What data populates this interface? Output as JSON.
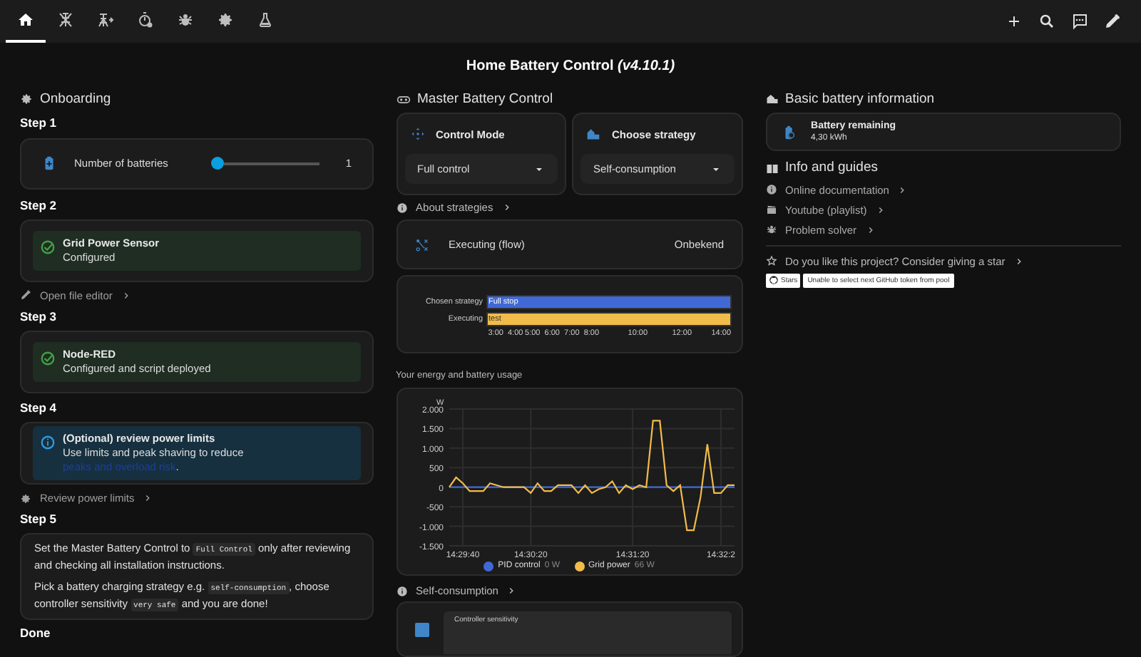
{
  "toolbar": {
    "tabs": [
      {
        "selected": true
      },
      {
        "selected": false
      },
      {
        "selected": false
      },
      {
        "selected": false
      },
      {
        "selected": false
      },
      {
        "selected": false
      },
      {
        "selected": false
      }
    ]
  },
  "title": {
    "name": "Home Battery Control",
    "version": "(v4.10.1)"
  },
  "onboarding": {
    "heading": "Onboarding",
    "steps": [
      {
        "title": "Step 1",
        "kind": "slider",
        "label": "Number of batteries",
        "reading": "1"
      },
      {
        "title": "Step 2",
        "kind": "success",
        "label": "Grid Power Sensor",
        "detail": "Configured",
        "link": "Open file editor"
      },
      {
        "title": "Step 3",
        "kind": "success",
        "label": "Node-RED",
        "detail": "Configured and script deployed"
      },
      {
        "title": "Step 4",
        "kind": "info",
        "label": "(Optional) review power limits",
        "detail": "Use limits and peak shaving to reduce ",
        "detail_link": "peaks and overload risk",
        "detail_end": ".",
        "link": "Review power limits"
      },
      {
        "title": "Step 5",
        "kind": "text",
        "paragraphs": [
          [
            "Set the Master Battery Control to ",
            {
              "code": "Full Control"
            },
            " only after reviewing and checking all installation instructions."
          ],
          [
            "Pick a battery charging strategy e.g. ",
            {
              "code": "self-consumption"
            },
            ", choose controller sensitivity ",
            {
              "code": "very safe"
            },
            " and you are done!"
          ]
        ]
      },
      {
        "title": "Done",
        "kind": "heading"
      }
    ]
  },
  "master": {
    "heading": "Master Battery Control",
    "selects": [
      {
        "label": "Control Mode",
        "value": "Full control"
      },
      {
        "label": "Choose strategy",
        "value": "Self-consumption"
      }
    ],
    "about_link": "About strategies",
    "executing": {
      "label": "Executing (flow)",
      "value": "Onbekend"
    },
    "timeline": {
      "rows": [
        {
          "label": "Chosen strategy",
          "value": "Full stop",
          "color": "#4169d6"
        },
        {
          "label": "Executing",
          "value": "test",
          "color": "#f2bc4a"
        }
      ],
      "ticks": [
        "3:00",
        "4:00",
        "5:00",
        "6:00",
        "7:00",
        "8:00",
        "10:00",
        "12:00",
        "14:00"
      ]
    },
    "usage_heading": "Your energy and battery usage",
    "chart_data": {
      "type": "line",
      "ylabel": "W",
      "ylim": [
        -1500,
        2000
      ],
      "grid": true,
      "legend": true,
      "yticks": [
        {
          "value": 2000,
          "label": "2.000"
        },
        {
          "value": 1500,
          "label": "1.500"
        },
        {
          "value": 1000,
          "label": "1.000"
        },
        {
          "value": 500,
          "label": "500"
        },
        {
          "value": 0,
          "label": "0"
        },
        {
          "value": -500,
          "label": "-500"
        },
        {
          "value": -1000,
          "label": "-1.000"
        },
        {
          "value": -1500,
          "label": "-1.500"
        }
      ],
      "categories": [
        null,
        null,
        "14:29:40",
        null,
        null,
        null,
        null,
        null,
        null,
        null,
        null,
        null,
        "14:30:20",
        null,
        null,
        null,
        null,
        null,
        null,
        null,
        null,
        null,
        null,
        null,
        null,
        null,
        null,
        "14:31:20",
        null,
        null,
        null,
        null,
        null,
        null,
        null,
        null,
        null,
        null,
        null,
        null,
        "14:32:2",
        null,
        null
      ],
      "series": [
        {
          "name": "PID control",
          "color": "#4169d6",
          "values": [
            0,
            0,
            0,
            0,
            0,
            0,
            0,
            0,
            0,
            0,
            0,
            0,
            0,
            0,
            0,
            0,
            0,
            0,
            0,
            0,
            0,
            0,
            0,
            0,
            0,
            0,
            0,
            0,
            0,
            0,
            0,
            0,
            0,
            0,
            0,
            0,
            0,
            0,
            0,
            0,
            0,
            0,
            0
          ]
        },
        {
          "name": "Grid power",
          "color": "#f2bc4a",
          "values": [
            0,
            250,
            100,
            -100,
            -100,
            -100,
            100,
            50,
            0,
            0,
            0,
            0,
            -150,
            100,
            -100,
            -100,
            50,
            50,
            50,
            -150,
            50,
            -150,
            -50,
            0,
            150,
            -150,
            50,
            -50,
            50,
            0,
            1700,
            1700,
            50,
            -100,
            50,
            -1100,
            -1100,
            -250,
            1100,
            -150,
            -150,
            50,
            50
          ]
        }
      ]
    },
    "legend_readings": [
      "0 W",
      "66 W"
    ],
    "strategy_link": "Self-consumption",
    "sensitivity_label": "Controller sensitivity"
  },
  "info": {
    "heading": "Basic battery information",
    "battery": {
      "label": "Battery remaining",
      "value": "4,30 kWh"
    },
    "guides_heading": "Info and guides",
    "links": [
      "Online documentation",
      "Youtube (playlist)",
      "Problem solver"
    ],
    "star_prompt": "Do you like this project? Consider giving a star",
    "badge": {
      "label": "Stars",
      "message": "Unable to select next GitHub token from pool"
    }
  }
}
